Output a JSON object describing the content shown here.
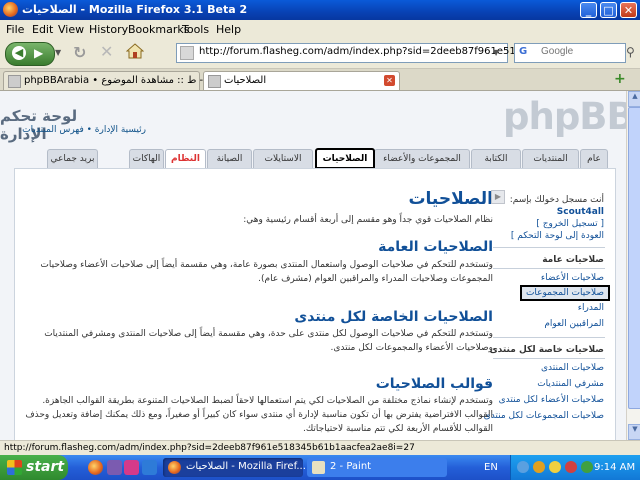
{
  "window": {
    "title": "الصلاحيات - Mozilla Firefox 3.1 Beta 2",
    "minimize": "_",
    "maximize": "□",
    "close": "✕"
  },
  "menu": [
    "File",
    "Edit",
    "View",
    "History",
    "Bookmarks",
    "Tools",
    "Help"
  ],
  "toolbar": {
    "url": "http://forum.flasheg.com/adm/index.php?sid=2deeb87f961e518345b6",
    "search_placeholder": "Google",
    "search_engine_icon": "google-icon"
  },
  "browser_tabs": [
    {
      "label": "phpBBArabia • ط :: مشاهدة الموضوع - ...",
      "active": false
    },
    {
      "label": "الصلاحيات",
      "active": true
    }
  ],
  "page": {
    "logo": "phpBB",
    "acp_title": "لوحة تحكم الإدارة",
    "acp_subtitle": "رئيسية الإدارة • فهرس المنتديات",
    "tabs": [
      "عام",
      "المنتديات",
      "الكتابة",
      "المجموعات والأعضاء",
      "الصلاحيات",
      "الاستايلات",
      "الصيانة",
      "النظام",
      "الهاكات",
      "بريد جماعي"
    ],
    "active_tab_index": 4,
    "sidebar": {
      "login_text": "أنت مسجل دخولك بإسم:",
      "username": "Scout4all",
      "logout": "[ تسجيل الخروج ]",
      "back_link": "العودة إلى لوحة التحكم ]",
      "section1_title": "صلاحيات عامة",
      "section1_items": [
        "صلاحيات الأعضاء",
        "صلاحيات المجموعات",
        "المدراء",
        "المراقبين العوام"
      ],
      "highlighted_item": "صلاحيات المجموعات",
      "section2_title": "صلاحيات خاصة لكل منتدى",
      "section2_items": [
        "صلاحيات المنتدى",
        "مشرفي المنتديات",
        "صلاحيات الأعضاء لكل منتدى",
        "صلاحيات المجموعات لكل منتدى"
      ]
    },
    "main": {
      "title": "الصلاحيات",
      "intro": "نظام الصلاحيات قوي جداً وهو مقسم إلى أربعة أقسام رئيسية وهي:",
      "sections": [
        {
          "title": "الصلاحيات العامة",
          "text": "وتستخدم للتحكم في صلاحيات الوصول واستعمال المنتدى بصورة عامة، وهي مقسمة أيضاً إلى صلاحيات الأعضاء وصلاحيات المجموعات وصلاحيات المدراء والمراقبين العوام (مشرف عام)."
        },
        {
          "title": "الصلاحيات الخاصة لكل منتدى",
          "text": "وتستخدم للتحكم في صلاحيات الوصول لكل منتدى على حدة، وهي مقسمة أيضاً إلى صلاحيات المنتدى ومشرفي المنتديات وصلاحيات الأعضاء والمجموعات لكل منتدى."
        },
        {
          "title": "قوالب الصلاحيات",
          "text": "وتستخدم لإنشاء نماذج مختلفة من الصلاحيات لكي يتم استعمالها لاحقاً لضبط الصلاحيات المتنوعة بطريقة القوالب الجاهزة. القوالب الافتراضية يفترض بها أن تكون مناسبة لإدارة أي منتدى سواء كان كبيراً أو صغيراً، ومع ذلك يمكنك إضافة وتعديل وحذف القوالب للأقسام الأربعة لكي تتم مناسبة لاحتياجاتك."
        }
      ]
    }
  },
  "statusbar": "http://forum.flasheg.com/adm/index.php?sid=2deeb87f961e518345b61b1aacfea2ae8i=27",
  "taskbar": {
    "start": "start",
    "tasks": [
      "الصلاحيات - Mozilla Firef...",
      "2 - Paint"
    ],
    "lang": "EN",
    "clock": "9:14 AM"
  }
}
